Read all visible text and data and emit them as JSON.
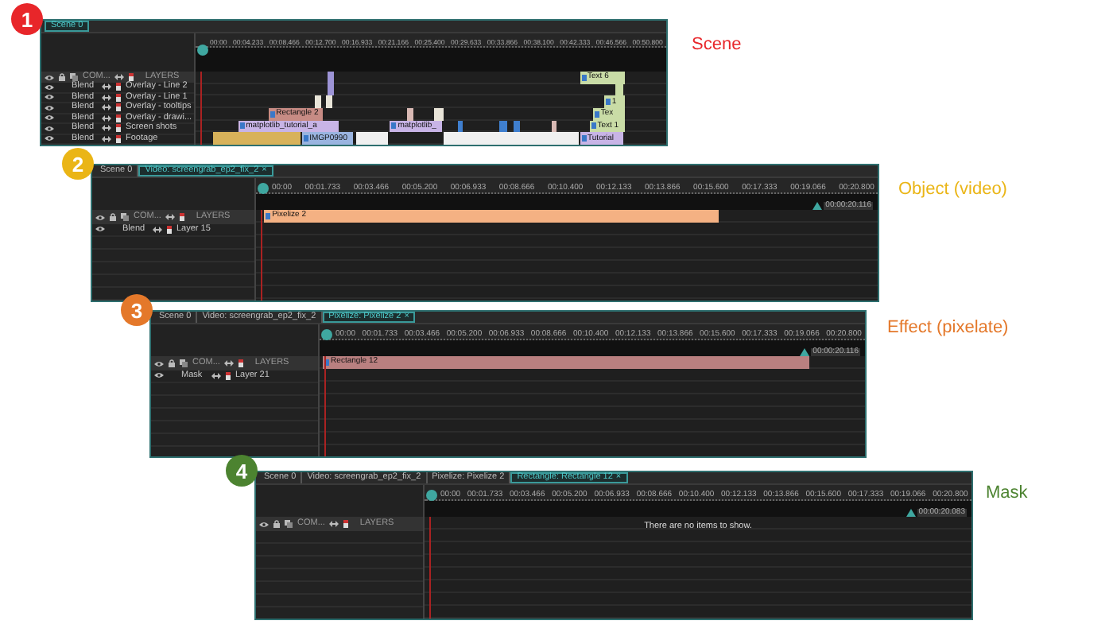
{
  "panels": [
    {
      "number": "1",
      "color": "#e8262a",
      "caption": "Scene",
      "tabs": [
        {
          "label": "Scene 0",
          "selected": true
        }
      ],
      "header": {
        "compositing": "COM...",
        "layers": "LAYERS"
      },
      "ruler_ticks": [
        "00:00",
        "00:04.233",
        "00:08.466",
        "00:12.700",
        "00:16.933",
        "00:21.166",
        "00:25.400",
        "00:29.633",
        "00:33.866",
        "00:38.100",
        "00:42.333",
        "00:46.566",
        "00:50.800"
      ],
      "layers": [
        {
          "mode": "Blend",
          "name": "Overlay - Line 2",
          "clips": [
            {
              "color": "#9d94d6"
            },
            {
              "label": "Text 6",
              "color": "#c9dca6"
            }
          ]
        },
        {
          "mode": "Blend",
          "name": "Overlay - Line 1",
          "clips": [
            {
              "color": "#9d94d6"
            },
            {
              "color": "#c9dca6"
            }
          ]
        },
        {
          "mode": "Blend",
          "name": "Overlay - tooltips",
          "clips": [
            {
              "color": "#e8e4d8"
            },
            {
              "color": "#e8e4d8"
            },
            {
              "label": "1",
              "color": "#c9dca6"
            }
          ]
        },
        {
          "mode": "Blend",
          "name": "Overlay - drawi...",
          "clips": [
            {
              "label": "Rectangle 2",
              "color": "#c78b84"
            },
            {
              "color": "#d9b9b4"
            },
            {
              "color": "#e8e4d8"
            },
            {
              "label": "Tex",
              "color": "#c9dca6"
            }
          ]
        },
        {
          "mode": "Blend",
          "name": "Screen shots",
          "clips": [
            {
              "label": "matplotlib_tutorial_a",
              "color": "#c8b4e6"
            },
            {
              "label": "matplotlib_",
              "color": "#c8b4e6"
            },
            {
              "color": "#3f7fcf"
            },
            {
              "color": "#3f7fcf"
            },
            {
              "color": "#3f7fcf"
            },
            {
              "color": "#d9b9b4"
            },
            {
              "label": "Text 1",
              "color": "#c9dca6"
            }
          ]
        },
        {
          "mode": "Blend",
          "name": "Footage",
          "clips": [
            {
              "color": "#d8b25a"
            },
            {
              "label": "IMGP0990",
              "color": "#9ab4e0"
            },
            {
              "color": "#f0f0f0"
            },
            {
              "color": "#f0f0f0"
            },
            {
              "label": "Tutorial",
              "color": "#c8b4e6"
            }
          ]
        }
      ]
    },
    {
      "number": "2",
      "color": "#eab516",
      "caption": "Object (video)",
      "tabs": [
        {
          "label": "Scene 0",
          "selected": false
        },
        {
          "label": "Video: screengrab_ep2_fix_2",
          "selected": true,
          "close": "×"
        }
      ],
      "header": {
        "compositing": "COM...",
        "layers": "LAYERS"
      },
      "ruler_ticks": [
        "00:00",
        "00:01.733",
        "00:03.466",
        "00:05.200",
        "00:06.933",
        "00:08.666",
        "00:10.400",
        "00:12.133",
        "00:13.866",
        "00:15.600",
        "00:17.333",
        "00:19.066",
        "00:20.800"
      ],
      "end_marker": "00:00:20.116",
      "layers": [
        {
          "mode": "Blend",
          "name": "Layer 15",
          "clips": [
            {
              "label": "Pixelize 2",
              "color": "#f4b183"
            }
          ]
        }
      ]
    },
    {
      "number": "3",
      "color": "#e4782a",
      "caption": "Effect (pixelate)",
      "tabs": [
        {
          "label": "Scene 0",
          "selected": false
        },
        {
          "label": "Video: screengrab_ep2_fix_2",
          "selected": false
        },
        {
          "label": "Pixelize: Pixelize 2",
          "selected": true,
          "close": "×"
        }
      ],
      "header": {
        "compositing": "COM...",
        "layers": "LAYERS"
      },
      "ruler_ticks": [
        "00:00",
        "00:01.733",
        "00:03.466",
        "00:05.200",
        "00:06.933",
        "00:08.666",
        "00:10.400",
        "00:12.133",
        "00:13.866",
        "00:15.600",
        "00:17.333",
        "00:19.066",
        "00:20.800"
      ],
      "end_marker": "00:00:20.116",
      "layers": [
        {
          "mode": "Mask",
          "name": "Layer 21",
          "clips": [
            {
              "label": "Rectangle 12",
              "color": "#b98080"
            }
          ]
        }
      ]
    },
    {
      "number": "4",
      "color": "#4c8330",
      "caption": "Mask",
      "tabs": [
        {
          "label": "Scene 0",
          "selected": false
        },
        {
          "label": "Video: screengrab_ep2_fix_2",
          "selected": false
        },
        {
          "label": "Pixelize: Pixelize 2",
          "selected": false
        },
        {
          "label": "Rectangle: Rectangle 12",
          "selected": true,
          "close": "×"
        }
      ],
      "header": {
        "compositing": "COM...",
        "layers": "LAYERS"
      },
      "ruler_ticks": [
        "00:00",
        "00:01.733",
        "00:03.466",
        "00:05.200",
        "00:06.933",
        "00:08.666",
        "00:10.400",
        "00:12.133",
        "00:13.866",
        "00:15.600",
        "00:17.333",
        "00:19.066",
        "00:20.800"
      ],
      "end_marker": "00:00:20.083",
      "empty_message": "There are no items to show."
    }
  ]
}
